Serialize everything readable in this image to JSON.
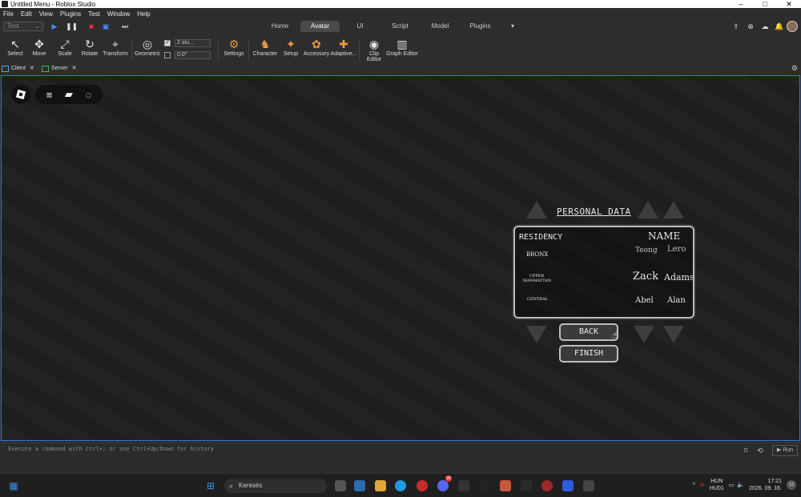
{
  "window": {
    "title": "Untitled Menu - Roblox Studio",
    "min": "–",
    "max": "□",
    "close": "✕"
  },
  "menu": [
    "File",
    "Edit",
    "View",
    "Plugins",
    "Test",
    "Window",
    "Help"
  ],
  "topbar": {
    "test_select": "Test",
    "tabs": [
      "Home",
      "Avatar",
      "UI",
      "Script",
      "Model",
      "Plugins"
    ],
    "active_tab": "Avatar"
  },
  "ribbon": {
    "tools": [
      "Select",
      "Move",
      "Scale",
      "Rotate",
      "Transform",
      "Geometric"
    ],
    "snap_move": "2 stu...",
    "snap_rotate": "0.0°",
    "avatar_tools": [
      "Settings",
      "Character",
      "Setup",
      "Accessory",
      "Adaptive...",
      "Clip Editor",
      "Graph Editor"
    ]
  },
  "doc_tabs": [
    "Client",
    "Server"
  ],
  "game_ui": {
    "heading": "PERSONAL DATA",
    "residency_label": "RESIDENCY",
    "name_label": "NAME",
    "residencies": [
      "BRONX",
      "UPPER MANHATTAN",
      "CENTRAL"
    ],
    "name_rows": [
      {
        "first": "Teong",
        "last": "Lero"
      },
      {
        "first": "Zack",
        "last": "Adams"
      },
      {
        "first": "Abel",
        "last": "Alan"
      }
    ],
    "back": "BACK",
    "finish": "FINISH"
  },
  "command": {
    "placeholder": "Execute a command with Ctrl+; or use Ctrl+Up/Down for history",
    "run": "Run"
  },
  "taskbar": {
    "search": "Keresés",
    "lang_top": "HUN",
    "lang_bottom": "HU01",
    "time": "17:21",
    "date": "2026. 09. 16.",
    "notif": "12",
    "badge": "99"
  },
  "colors": {
    "accent": "#3b6fe8",
    "panel_border": "#bdbdbd"
  }
}
